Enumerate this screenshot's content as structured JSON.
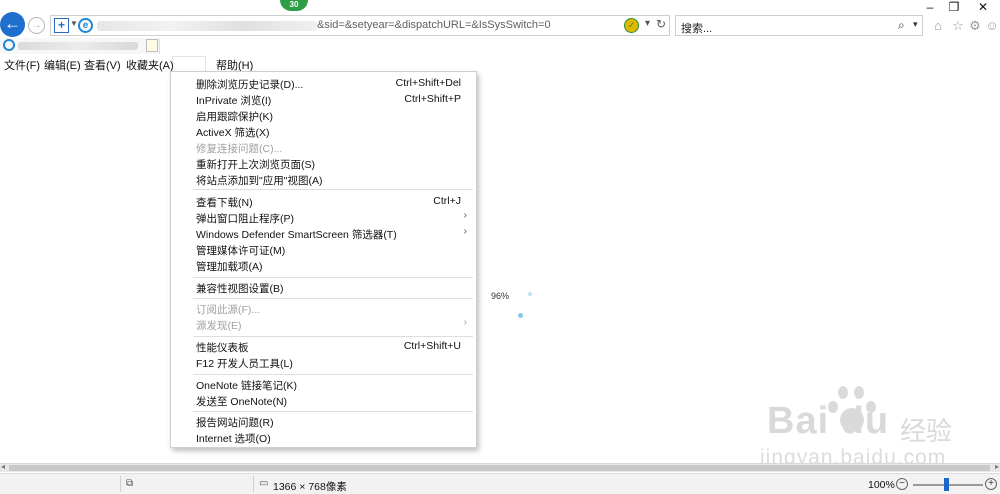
{
  "address": {
    "url": "&sid=&setyear=&dispatchURL=&IsSysSwitch=0"
  },
  "badge": "30",
  "search": {
    "placeholder": "搜索..."
  },
  "menubar": {
    "items": [
      "文件(F)",
      "编辑(E)",
      "查看(V)",
      "收藏夹(A)",
      "帮助(H)"
    ]
  },
  "tools_menu": {
    "items": [
      {
        "label": "删除浏览历史记录(D)...",
        "shortcut": "Ctrl+Shift+Del",
        "disabled": false
      },
      {
        "label": "InPrivate 浏览(I)",
        "shortcut": "Ctrl+Shift+P",
        "disabled": false
      },
      {
        "label": "启用跟踪保护(K)",
        "shortcut": "",
        "disabled": false
      },
      {
        "label": "ActiveX 筛选(X)",
        "shortcut": "",
        "disabled": false
      },
      {
        "label": "修复连接问题(C)...",
        "shortcut": "",
        "disabled": true
      },
      {
        "label": "重新打开上次浏览页面(S)",
        "shortcut": "",
        "disabled": false
      },
      {
        "label": "将站点添加到\"应用\"视图(A)",
        "shortcut": "",
        "disabled": false
      },
      {
        "label": "查看下载(N)",
        "shortcut": "Ctrl+J",
        "disabled": false
      },
      {
        "label": "弹出窗口阻止程序(P)",
        "shortcut": "",
        "submenu": true,
        "disabled": false
      },
      {
        "label": "Windows Defender SmartScreen 筛选器(T)",
        "shortcut": "",
        "submenu": true,
        "disabled": false
      },
      {
        "label": "管理媒体许可证(M)",
        "shortcut": "",
        "disabled": false
      },
      {
        "label": "管理加载项(A)",
        "shortcut": "",
        "disabled": false
      },
      {
        "label": "兼容性视图设置(B)",
        "shortcut": "",
        "disabled": false
      },
      {
        "label": "订阅此源(F)...",
        "shortcut": "",
        "disabled": true
      },
      {
        "label": "源发现(E)",
        "shortcut": "",
        "submenu": true,
        "disabled": true
      },
      {
        "label": "性能仪表板",
        "shortcut": "Ctrl+Shift+U",
        "disabled": false
      },
      {
        "label": "F12 开发人员工具(L)",
        "shortcut": "",
        "disabled": false
      },
      {
        "label": "OneNote 链接笔记(K)",
        "shortcut": "",
        "disabled": false
      },
      {
        "label": "发送至 OneNote(N)",
        "shortcut": "",
        "disabled": false
      },
      {
        "label": "报告网站问题(R)",
        "shortcut": "",
        "disabled": false
      },
      {
        "label": "Internet 选项(O)",
        "shortcut": "",
        "disabled": false
      }
    ]
  },
  "loading": {
    "percent": "96%"
  },
  "watermark": {
    "logo": "Bai du",
    "brand": "经验",
    "url": "jingyan.baidu.com"
  },
  "status": {
    "resolution": "1366 × 768像素",
    "zoom": "100%"
  },
  "icons": {
    "back": "back-arrow-icon",
    "forward": "forward-arrow-icon",
    "home": "home-icon",
    "favorites": "star-icon",
    "settings": "gear-icon",
    "smiley": "smiley-icon"
  },
  "colors": {
    "accent": "#1f6fcf",
    "badge": "#2e9e46",
    "slider": "#1c66c9"
  }
}
